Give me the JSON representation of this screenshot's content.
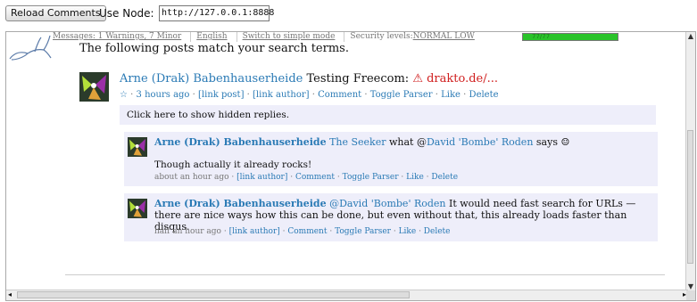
{
  "toolbar": {
    "reload_label": "Reload Comments",
    "node_label": "Use Node:",
    "node_value": "http://127.0.0.1:8888"
  },
  "status": {
    "messages": "Messages: 1 Warnings, 7 Minor",
    "language": "English",
    "mode": "Switch to simple mode",
    "security_prefix": "Security levels:",
    "security_levels": "NORMAL LOW",
    "progress_text": "77/77",
    "progress_fraction": 1.0,
    "progress_color": "#2ac32a"
  },
  "intro": "The following posts match your search terms.",
  "post": {
    "author": "Arne (Drak) Babenhauserheide",
    "title": "Testing Freecom:",
    "warn_link": "⚠ drakto.de/...",
    "star": "☆",
    "time": "3 hours ago",
    "actions": [
      "[link post]",
      "[link author]",
      "Comment",
      "Toggle Parser",
      "Like",
      "Delete"
    ],
    "hidden_replies": "Click here to show hidden replies."
  },
  "replies": [
    {
      "author": "Arne (Drak) Babenhauserheide",
      "to": "The Seeker",
      "text_mid": "what @",
      "mention": "David 'Bombe' Roden",
      "text_end": "says ☺",
      "body": "Though actually it already rocks!",
      "time": "about an hour ago",
      "actions": [
        "[link author]",
        "Comment",
        "Toggle Parser",
        "Like",
        "Delete"
      ]
    },
    {
      "author": "Arne (Drak) Babenhauserheide",
      "mention": "@David 'Bombe' Roden",
      "text": "It would need fast search for URLs — there are nice ways how this can be done, but even without that, this already loads faster than disqus.",
      "time": "half an hour ago",
      "actions": [
        "[link author]",
        "Comment",
        "Toggle Parser",
        "Like",
        "Delete"
      ]
    }
  ],
  "colors": {
    "link": "#2a7ab5",
    "reply_bg": "#eeeefa",
    "warn": "#d02020"
  }
}
